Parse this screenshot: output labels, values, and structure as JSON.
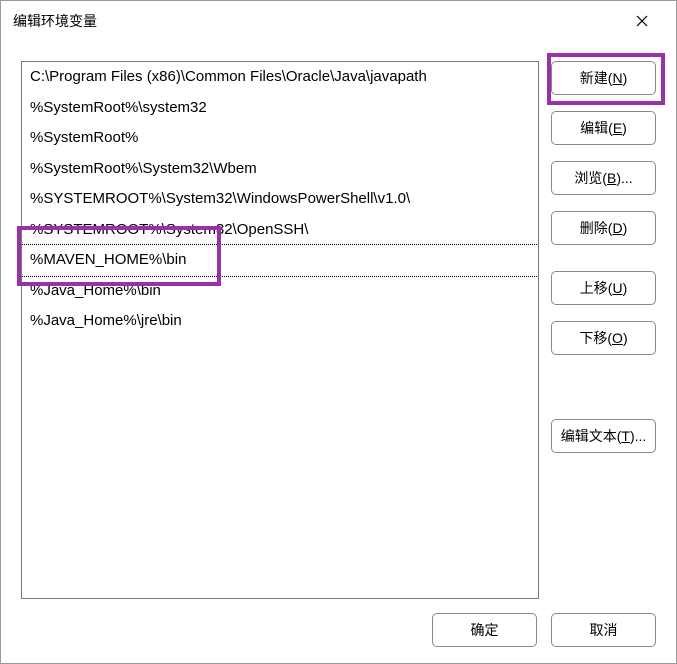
{
  "title": "编辑环境变量",
  "list_items": [
    "C:\\Program Files (x86)\\Common Files\\Oracle\\Java\\javapath",
    "%SystemRoot%\\system32",
    "%SystemRoot%",
    "%SystemRoot%\\System32\\Wbem",
    "%SYSTEMROOT%\\System32\\WindowsPowerShell\\v1.0\\",
    "%SYSTEMROOT%\\System32\\OpenSSH\\",
    "%MAVEN_HOME%\\bin",
    "%Java_Home%\\bin",
    "%Java_Home%\\jre\\bin"
  ],
  "active_index": 6,
  "buttons": {
    "new_pre": "新建(",
    "new_u": "N",
    "new_post": ")",
    "edit_pre": "编辑(",
    "edit_u": "E",
    "edit_post": ")",
    "browse_pre": "浏览(",
    "browse_u": "B",
    "browse_post": ")...",
    "delete_pre": "删除(",
    "delete_u": "D",
    "delete_post": ")",
    "up_pre": "上移(",
    "up_u": "U",
    "up_post": ")",
    "down_pre": "下移(",
    "down_u": "O",
    "down_post": ")",
    "edittext_pre": "编辑文本(",
    "edittext_u": "T",
    "edittext_post": ")...",
    "ok": "确定",
    "cancel": "取消"
  }
}
